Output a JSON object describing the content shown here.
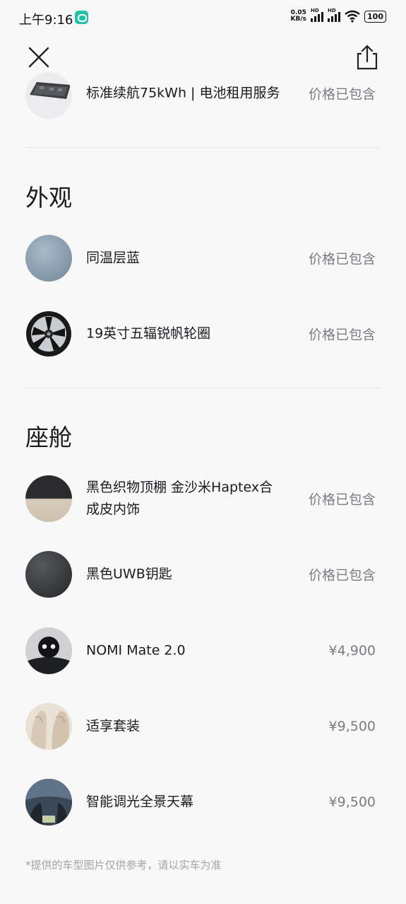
{
  "status_bar": {
    "time": "上午9:16",
    "net_speed_value": "0.05",
    "net_speed_unit": "KB/s",
    "signal_label": "HD",
    "battery": "100"
  },
  "header": {
    "close_icon": "close-icon",
    "share_icon": "share-icon"
  },
  "battery_row": {
    "name": "标准续航75kWh | 电池租用服务",
    "price": "价格已包含"
  },
  "exterior": {
    "title": "外观",
    "items": [
      {
        "name": "同温层蓝",
        "price": "价格已包含",
        "swatch": "#8fa2b2"
      },
      {
        "name": "19英寸五辐锐帆轮圈",
        "price": "价格已包含"
      }
    ]
  },
  "cabin": {
    "title": "座舱",
    "items": [
      {
        "name": "黑色织物顶棚 金沙米Haptex合成皮内饰",
        "price": "价格已包含"
      },
      {
        "name": "黑色UWB钥匙",
        "price": "价格已包含"
      },
      {
        "name": "NOMI Mate 2.0",
        "price": "¥4,900"
      },
      {
        "name": "适享套装",
        "price": "¥9,500"
      },
      {
        "name": "智能调光全景天幕",
        "price": "¥9,500"
      }
    ]
  },
  "footnote": "*提供的车型图片仅供参考，请以实车为准",
  "colors": {
    "background": "#f8f8f9",
    "text": "#1b1b1f",
    "price_gray": "#7b7c81",
    "divider": "#e6e6e8"
  }
}
